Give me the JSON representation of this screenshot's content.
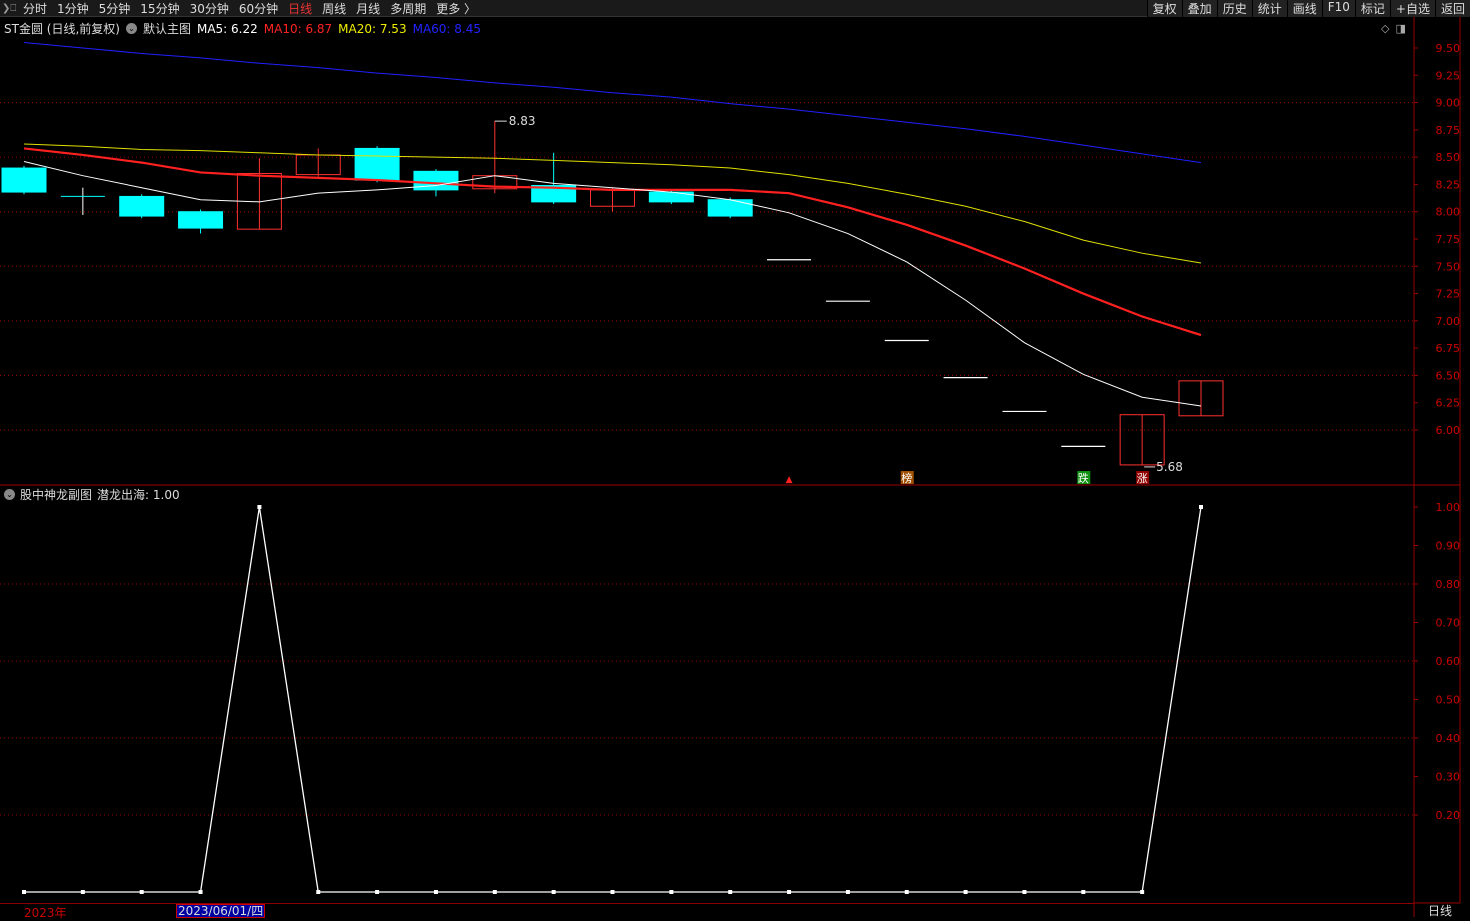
{
  "toolbar": {
    "periods": [
      "分时",
      "1分钟",
      "5分钟",
      "15分钟",
      "30分钟",
      "60分钟",
      "日线",
      "周线",
      "月线",
      "多周期",
      "更多 〉"
    ],
    "active": "日线",
    "actions": [
      "复权",
      "叠加",
      "历史",
      "统计",
      "画线",
      "F10",
      "标记",
      "+自选",
      "返回"
    ]
  },
  "legend": {
    "title": "ST金圆 (日线,前复权)",
    "main": "默认主图",
    "ma5": "MA5: 6.22",
    "ma10": "MA10: 6.87",
    "ma20": "MA20: 7.53",
    "ma60": "MA60: 8.45"
  },
  "colors": {
    "ma5": "#ffffff",
    "ma10": "#ff2020",
    "ma20": "#e0e000",
    "ma60": "#2020ff",
    "up": "#ff3030",
    "down": "#00ffff",
    "axis": "#c00000"
  },
  "sub_legend": {
    "name": "股中神龙副图",
    "value": "潜龙出海: 1.00"
  },
  "footer": {
    "year": "2023年",
    "cursor_date": "2023/06/01/四",
    "period": "日线"
  },
  "chart_data": {
    "type": "candlestick",
    "yaxis_ticks": [
      "9.50",
      "9.25",
      "9.00",
      "8.75",
      "8.50",
      "8.25",
      "8.00",
      "7.75",
      "7.50",
      "7.25",
      "7.00",
      "6.75",
      "6.50",
      "6.25",
      "6.00"
    ],
    "ylim": [
      5.55,
      9.6
    ],
    "candles": [
      [
        8.4,
        8.42,
        8.16,
        8.18
      ],
      [
        8.14,
        8.22,
        7.97,
        8.14
      ],
      [
        8.14,
        8.16,
        7.94,
        7.96
      ],
      [
        8.0,
        8.02,
        7.8,
        7.85
      ],
      [
        7.84,
        8.49,
        7.84,
        8.35
      ],
      [
        8.34,
        8.58,
        8.32,
        8.52
      ],
      [
        8.58,
        8.6,
        8.27,
        8.29
      ],
      [
        8.37,
        8.39,
        8.14,
        8.2
      ],
      [
        8.21,
        8.83,
        8.17,
        8.33
      ],
      [
        8.24,
        8.54,
        8.07,
        8.09
      ],
      [
        8.05,
        8.22,
        8.0,
        8.2
      ],
      [
        8.18,
        8.2,
        8.07,
        8.09
      ],
      [
        8.11,
        8.13,
        7.94,
        7.96
      ],
      [
        7.56,
        7.56,
        7.56,
        7.56
      ],
      [
        7.18,
        7.18,
        7.18,
        7.18
      ],
      [
        6.82,
        6.82,
        6.82,
        6.82
      ],
      [
        6.48,
        6.48,
        6.48,
        6.48
      ],
      [
        6.17,
        6.17,
        6.17,
        6.17
      ],
      [
        5.85,
        5.85,
        5.85,
        5.85
      ],
      [
        5.68,
        6.14,
        5.68,
        6.14
      ],
      [
        6.13,
        6.45,
        6.13,
        6.45
      ]
    ],
    "ma5": [
      8.46,
      8.33,
      8.22,
      8.11,
      8.09,
      8.17,
      8.2,
      8.24,
      8.33,
      8.26,
      8.22,
      8.18,
      8.11,
      7.99,
      7.8,
      7.54,
      7.19,
      6.8,
      6.51,
      6.3,
      6.22
    ],
    "ma10": [
      8.58,
      8.52,
      8.45,
      8.36,
      8.33,
      8.31,
      8.29,
      8.26,
      8.23,
      8.22,
      8.2,
      8.2,
      8.2,
      8.17,
      8.04,
      7.88,
      7.69,
      7.48,
      7.25,
      7.04,
      6.87
    ],
    "ma20": [
      8.62,
      8.6,
      8.57,
      8.56,
      8.54,
      8.52,
      8.51,
      8.5,
      8.49,
      8.47,
      8.45,
      8.43,
      8.4,
      8.34,
      8.26,
      8.16,
      8.05,
      7.91,
      7.74,
      7.62,
      7.53
    ],
    "ma60": [
      9.55,
      9.5,
      9.45,
      9.41,
      9.36,
      9.32,
      9.27,
      9.23,
      9.18,
      9.14,
      9.09,
      9.05,
      8.99,
      8.94,
      8.88,
      8.82,
      8.76,
      8.69,
      8.61,
      8.53,
      8.45
    ],
    "high_label": "8.83",
    "low_label": "5.68",
    "markers": [
      {
        "index": 13,
        "text": "▲",
        "color": "#ff2020"
      },
      {
        "index": 15,
        "text": "榜",
        "color": "#a05000"
      },
      {
        "index": 18,
        "text": "跌",
        "color": "#109010"
      },
      {
        "index": 19,
        "text": "涨",
        "color": "#900000"
      }
    ],
    "sub": {
      "yaxis_ticks": [
        "1.00",
        "0.90",
        "0.80",
        "0.70",
        "0.60",
        "0.50",
        "0.40",
        "0.30",
        "0.20"
      ],
      "values": [
        0,
        0,
        0,
        0,
        1,
        0,
        0,
        0,
        0,
        0,
        0,
        0,
        0,
        0,
        0,
        0,
        0,
        0,
        0,
        0,
        1
      ]
    }
  }
}
